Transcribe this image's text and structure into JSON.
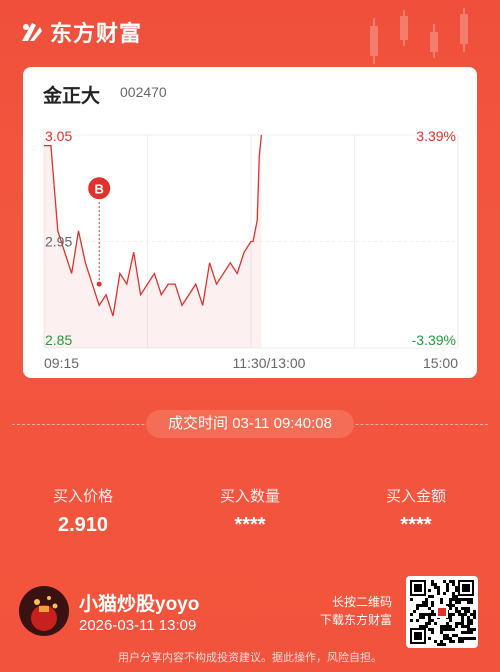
{
  "brand": {
    "name": "东方财富"
  },
  "stock": {
    "name": "金正大",
    "code": "002470"
  },
  "chart_data": {
    "type": "line",
    "title": "",
    "y_left_ticks": [
      "3.05",
      "2.95",
      "2.85"
    ],
    "y_right_ticks": [
      "3.39%",
      "-3.39%"
    ],
    "x_ticks": [
      "09:15",
      "11:30/13:00",
      "15:00"
    ],
    "ylim": [
      2.85,
      3.05
    ],
    "reference_price": 2.95,
    "trade_marker": {
      "label": "B",
      "price": 2.91
    },
    "x": [
      "09:15",
      "09:17",
      "09:19",
      "09:21",
      "09:23",
      "09:25",
      "09:30",
      "09:35",
      "09:40",
      "09:45",
      "09:50",
      "09:55",
      "10:00",
      "10:05",
      "10:10",
      "10:15",
      "10:20",
      "10:25",
      "10:30",
      "10:35",
      "10:40",
      "10:45",
      "10:50",
      "10:55",
      "11:00",
      "11:05",
      "11:10",
      "11:15",
      "11:20",
      "11:25",
      "11:30",
      "13:05",
      "13:10",
      "13:15",
      "13:20",
      "13:25"
    ],
    "series": [
      {
        "values": [
          3.04,
          3.04,
          2.96,
          2.94,
          2.92,
          2.96,
          2.93,
          2.91,
          2.89,
          2.9,
          2.88,
          2.92,
          2.91,
          2.94,
          2.9,
          2.91,
          2.92,
          2.9,
          2.91,
          2.91,
          2.89,
          2.9,
          2.91,
          2.89,
          2.93,
          2.91,
          2.92,
          2.93,
          2.92,
          2.94,
          2.95,
          2.95,
          2.96,
          2.97,
          3.03,
          3.05
        ]
      }
    ]
  },
  "trade": {
    "time_label": "成交时间",
    "time_value": "03-11 09:40:08",
    "price_label": "买入价格",
    "price_value": "2.910",
    "qty_label": "买入数量",
    "qty_value": "****",
    "amount_label": "买入金额",
    "amount_value": "****"
  },
  "user": {
    "name": "小猫炒股yoyo",
    "time": "2026-03-11 13:09"
  },
  "qr_hint": {
    "line1": "长按二维码",
    "line2": "下载东方财富"
  },
  "disclaimer": "用户分享内容不构成投资建议。据此操作，风险自担。",
  "colors": {
    "up": "#e0312b",
    "down": "#1f9d3c",
    "brand_bg": "#f2533c"
  }
}
